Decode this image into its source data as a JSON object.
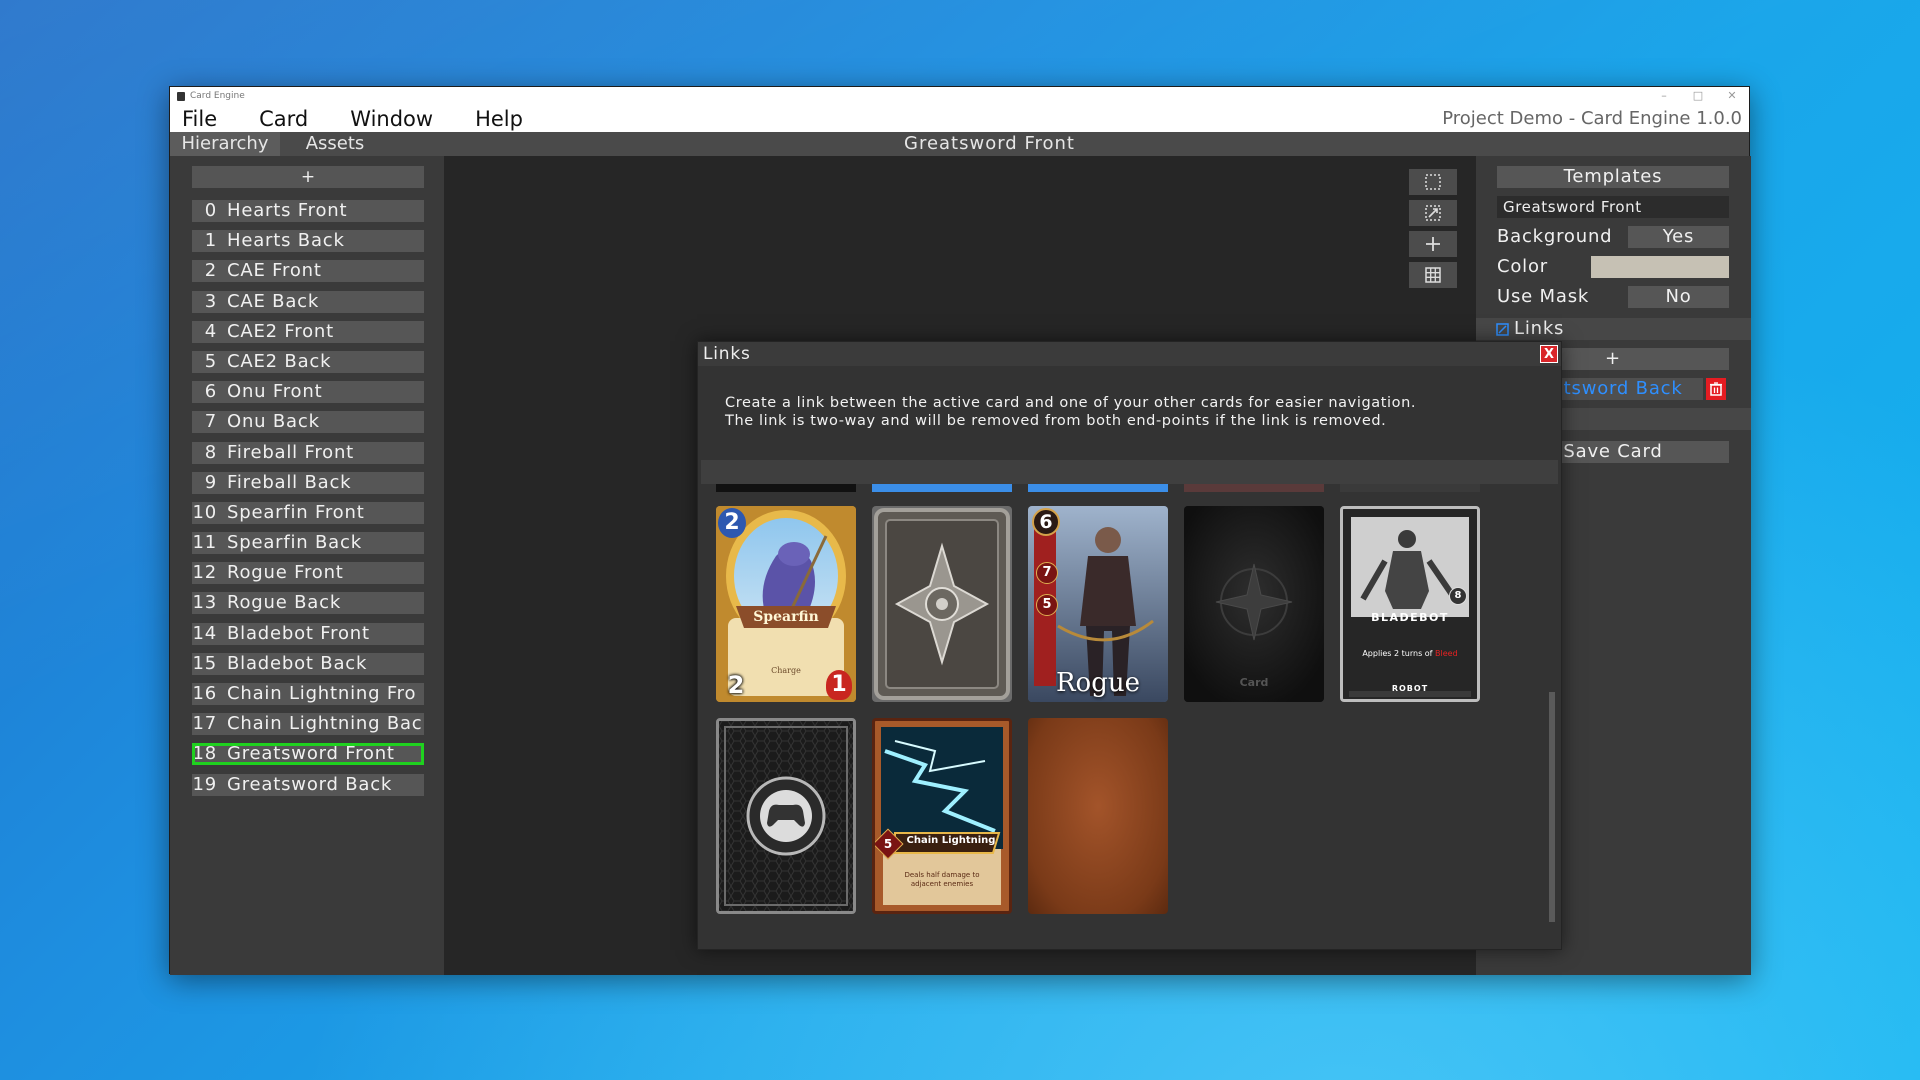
{
  "window": {
    "app_title": "Card Engine",
    "controls": [
      "–",
      "□",
      "✕"
    ],
    "project_title": "Project Demo - Card Engine 1.0.0"
  },
  "menu": [
    "File",
    "Card",
    "Window",
    "Help"
  ],
  "tabs": {
    "hierarchy": "Hierarchy",
    "assets": "Assets"
  },
  "canvas_title": "Greatsword Front",
  "hierarchy": {
    "add_label": "+",
    "items": [
      {
        "index": "0",
        "name": "Hearts Front"
      },
      {
        "index": "1",
        "name": "Hearts Back"
      },
      {
        "index": "2",
        "name": "CAE Front"
      },
      {
        "index": "3",
        "name": "CAE Back"
      },
      {
        "index": "4",
        "name": "CAE2 Front"
      },
      {
        "index": "5",
        "name": "CAE2 Back"
      },
      {
        "index": "6",
        "name": "Onu Front"
      },
      {
        "index": "7",
        "name": "Onu Back"
      },
      {
        "index": "8",
        "name": "Fireball Front"
      },
      {
        "index": "9",
        "name": "Fireball Back"
      },
      {
        "index": "10",
        "name": "Spearfin Front"
      },
      {
        "index": "11",
        "name": "Spearfin Back"
      },
      {
        "index": "12",
        "name": "Rogue Front"
      },
      {
        "index": "13",
        "name": "Rogue Back"
      },
      {
        "index": "14",
        "name": "Bladebot Front"
      },
      {
        "index": "15",
        "name": "Bladebot Back"
      },
      {
        "index": "16",
        "name": "Chain Lightning Fro"
      },
      {
        "index": "17",
        "name": "Chain Lightning Bac"
      },
      {
        "index": "18",
        "name": "Greatsword Front"
      },
      {
        "index": "19",
        "name": "Greatsword Back"
      }
    ],
    "active_index": 18
  },
  "inspector": {
    "templates_label": "Templates",
    "template_value": "Greatsword Front",
    "background_label": "Background",
    "background_value": "Yes",
    "color_label": "Color",
    "color_value": "#c6c1b4",
    "use_mask_label": "Use Mask",
    "use_mask_value": "No",
    "links_label": "Links",
    "links_add_label": "+",
    "link_item": "Greatsword Back",
    "save_label": "Save Card"
  },
  "modal": {
    "title": "Links",
    "close_label": "X",
    "description_line1": "Create a link between the active card and one of your other cards for easier navigation.",
    "description_line2": "The link is two-way and will be removed from both end-points if the link is removed."
  },
  "cards": {
    "spearfin": {
      "name": "Spearfin",
      "cost": "2",
      "attack": "2",
      "health": "1",
      "keyword": "Charge"
    },
    "rogue": {
      "name": "Rogue",
      "cost": "6",
      "stat1": "7",
      "stat2": "5"
    },
    "cae_back": {
      "logo": "Card"
    },
    "bladebot": {
      "name": "BLADEBOT",
      "badge": "8",
      "text_prefix": "Applies 2 turns of",
      "text_highlight": "Bleed",
      "type": "ROBOT"
    },
    "chain_lightning": {
      "name": "Chain Lightning",
      "cost": "5",
      "text": "Deals half damage to adjacent enemies"
    }
  },
  "colors": {
    "accent_green": "#1fd11f",
    "link_blue": "#2e8fff",
    "close_red": "#d9262a"
  }
}
